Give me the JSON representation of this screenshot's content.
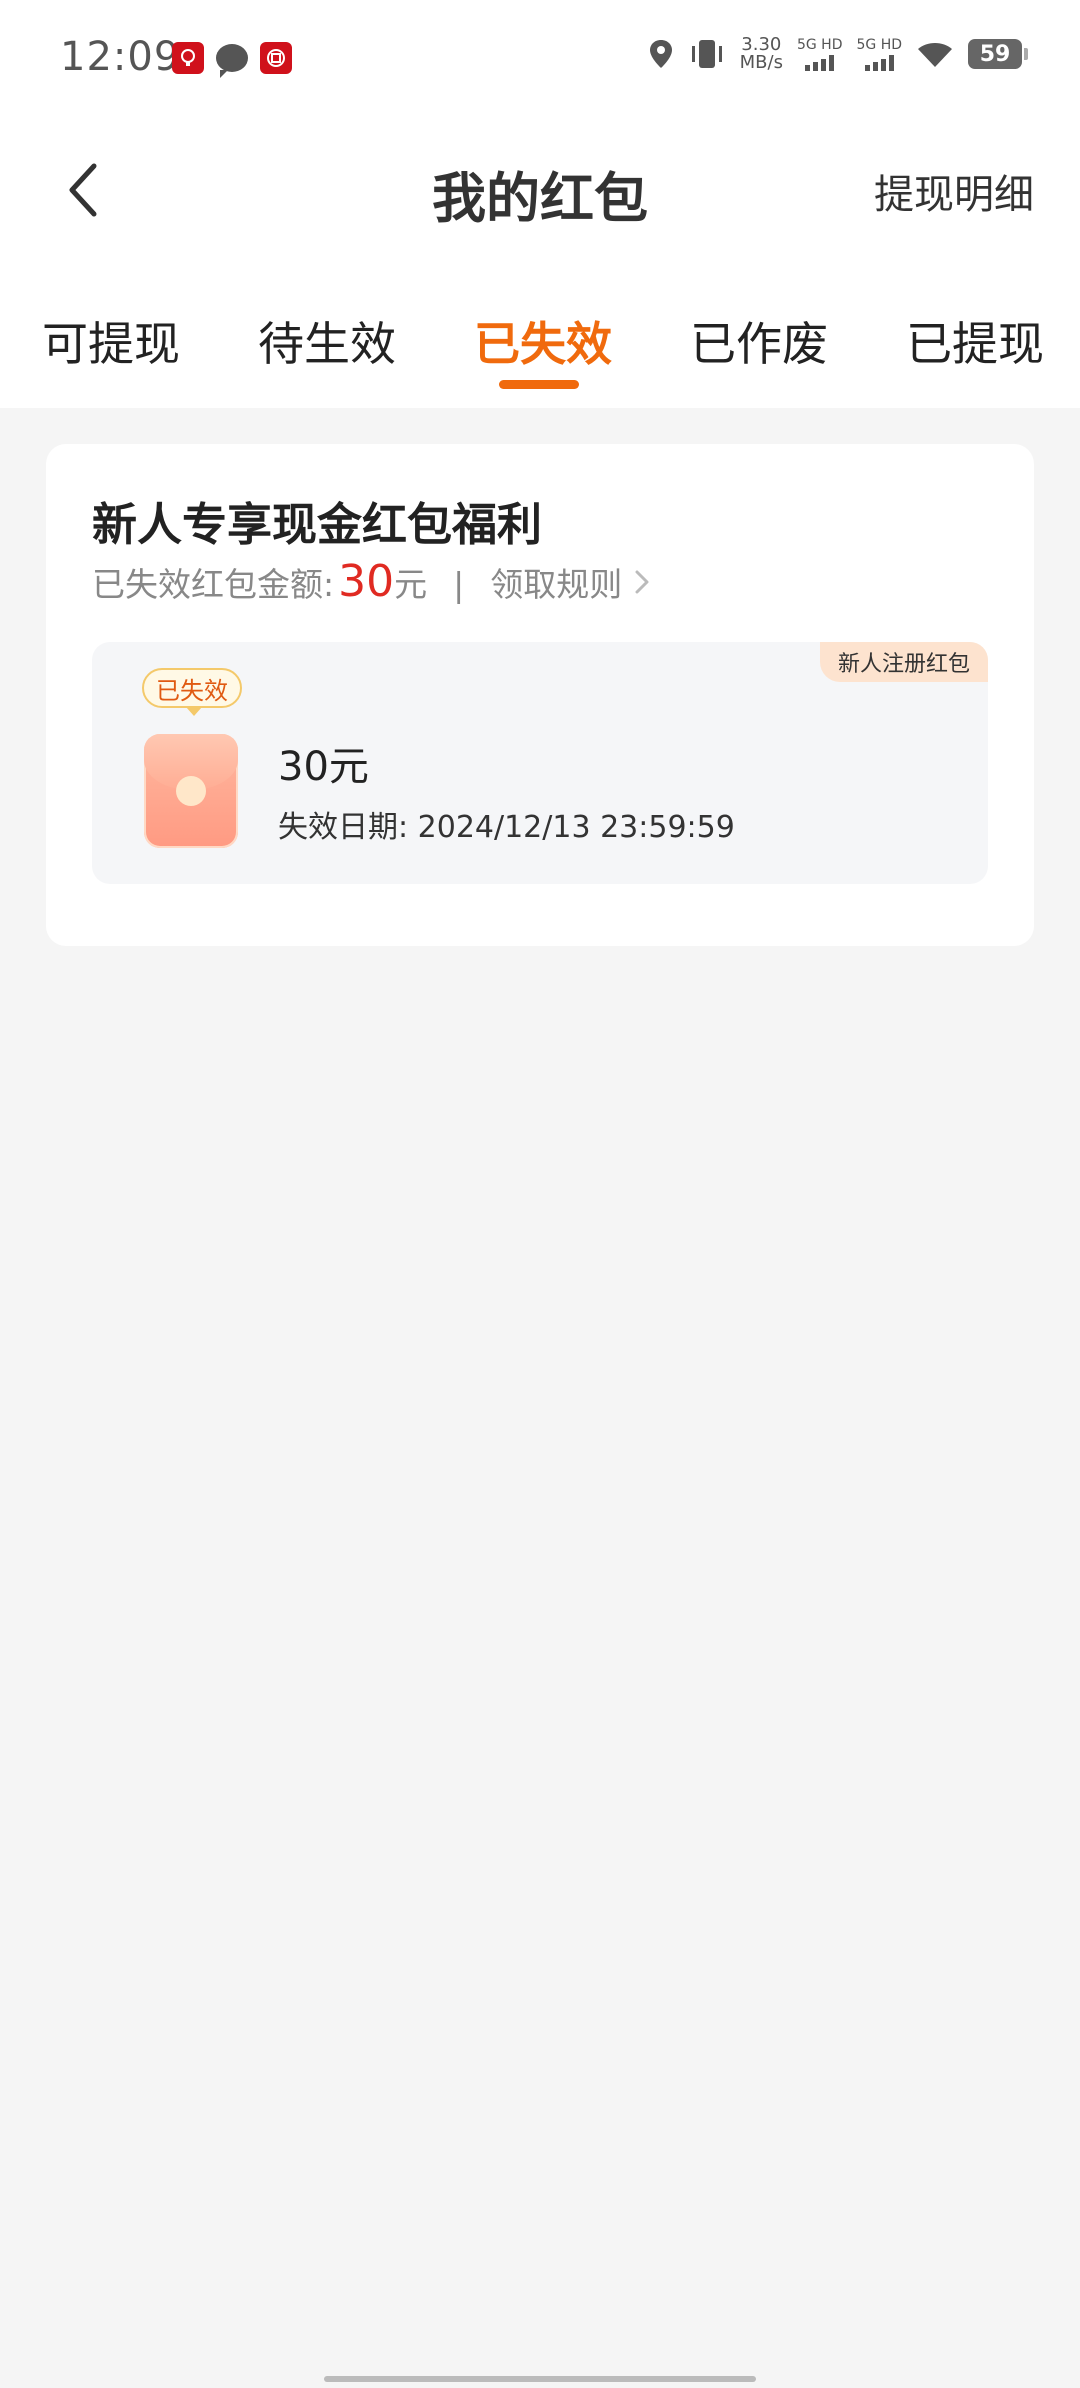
{
  "status_bar": {
    "time": "12:09",
    "app_badge_1": "TRAC",
    "speed_top": "3.30",
    "speed_bottom": "MB/s",
    "net_1": "5G HD",
    "net_2": "5G HD",
    "battery": "59"
  },
  "nav": {
    "title": "我的红包",
    "action": "提现明细"
  },
  "tabs": [
    {
      "label": "可提现"
    },
    {
      "label": "待生效"
    },
    {
      "label": "已失效"
    },
    {
      "label": "已作废"
    },
    {
      "label": "已提现"
    }
  ],
  "active_tab": 2,
  "card": {
    "title": "新人专享现金红包福利",
    "amount_label": "已失效红包金额:",
    "amount_value": "30",
    "amount_unit": "元",
    "separator": "|",
    "rules_label": "领取规则"
  },
  "coupon": {
    "corner_tag": "新人注册红包",
    "status_tag": "已失效",
    "amount": "30元",
    "expire_text": "失效日期: 2024/12/13 23:59:59"
  },
  "colors": {
    "accent": "#f06a0d",
    "amount_red": "#e02a22",
    "page_bg": "#f5f5f5"
  }
}
